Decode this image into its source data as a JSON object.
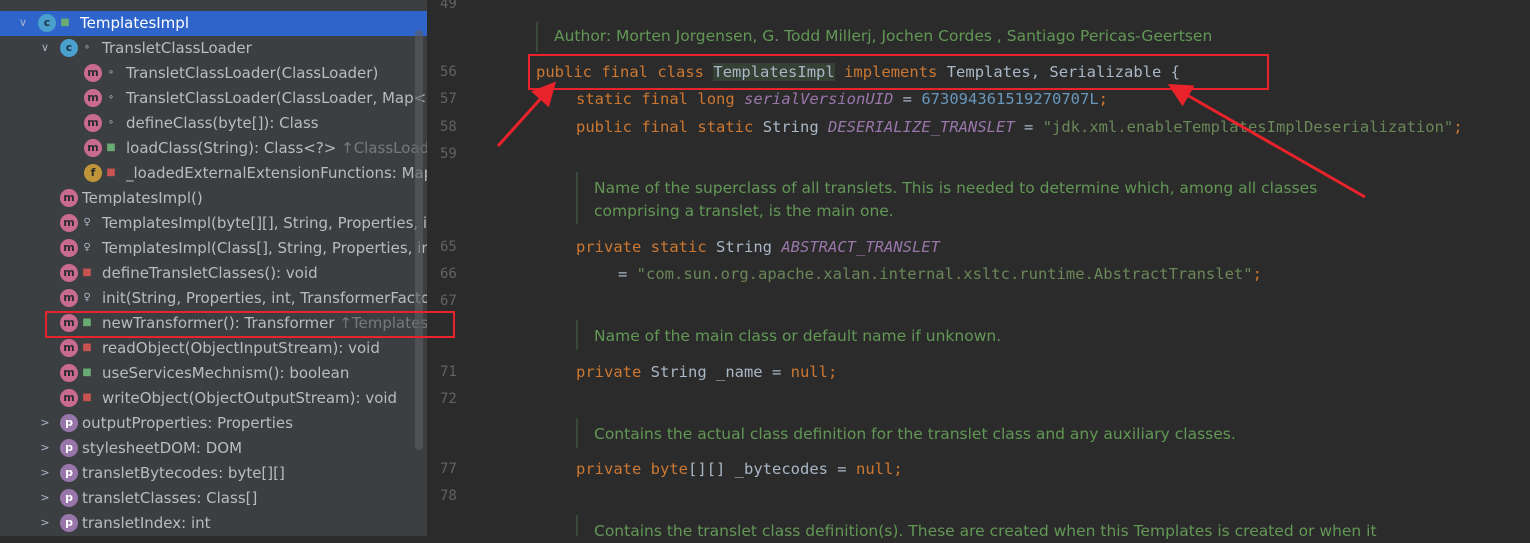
{
  "structure": {
    "rows": [
      {
        "arrow": "down",
        "icon": "c",
        "icon_name": "class-icon",
        "vis": "pub",
        "label": "TemplatesImpl",
        "hint": "",
        "selected": true
      },
      {
        "arrow": "down",
        "icon": "c",
        "icon_name": "inner-class-icon",
        "vis": "dot",
        "label": "TransletClassLoader",
        "hint": ""
      },
      {
        "icon": "m",
        "icon_name": "method-icon",
        "vis": "dot",
        "label": "TransletClassLoader(ClassLoader)",
        "hint": ""
      },
      {
        "icon": "m",
        "icon_name": "method-icon",
        "vis": "dot",
        "label": "TransletClassLoader(ClassLoader, Map<St",
        "hint": ""
      },
      {
        "icon": "m",
        "icon_name": "method-icon",
        "vis": "dot",
        "label": "defineClass(byte[]): Class",
        "hint": ""
      },
      {
        "icon": "m",
        "icon_name": "method-icon",
        "vis": "pub",
        "label": "loadClass(String): Class<?>",
        "hint": "↑ClassLoader"
      },
      {
        "icon": "f",
        "icon_name": "field-icon",
        "vis": "priv",
        "label": "_loadedExternalExtensionFunctions: Map<",
        "hint": ""
      },
      {
        "icon": "m",
        "icon_name": "method-icon",
        "vis": "none",
        "label": "TemplatesImpl()",
        "hint": ""
      },
      {
        "icon": "m",
        "icon_name": "method-icon",
        "vis": "pkg",
        "label": "TemplatesImpl(byte[][], String, Properties, in",
        "hint": ""
      },
      {
        "icon": "m",
        "icon_name": "method-icon",
        "vis": "pkg",
        "label": "TemplatesImpl(Class[], String, Properties, int",
        "hint": ""
      },
      {
        "icon": "m",
        "icon_name": "method-icon",
        "vis": "priv",
        "label": "defineTransletClasses(): void",
        "hint": ""
      },
      {
        "icon": "m",
        "icon_name": "method-icon",
        "vis": "pkg",
        "label": "init(String, Properties, int, TransformerFactor",
        "hint": ""
      },
      {
        "icon": "m",
        "icon_name": "method-icon",
        "vis": "pub",
        "label": "newTransformer(): Transformer",
        "hint": "↑Templates"
      },
      {
        "icon": "m",
        "icon_name": "method-icon",
        "vis": "priv",
        "label": "readObject(ObjectInputStream): void",
        "hint": ""
      },
      {
        "icon": "m",
        "icon_name": "method-icon",
        "vis": "pub",
        "label": "useServicesMechnism(): boolean",
        "hint": ""
      },
      {
        "icon": "m",
        "icon_name": "method-icon",
        "vis": "priv",
        "label": "writeObject(ObjectOutputStream): void",
        "hint": ""
      },
      {
        "arrow": "right",
        "icon": "p",
        "icon_name": "property-icon",
        "vis": "none",
        "label": "outputProperties: Properties",
        "hint": ""
      },
      {
        "arrow": "right",
        "icon": "p",
        "icon_name": "property-icon",
        "vis": "none",
        "label": "stylesheetDOM: DOM",
        "hint": ""
      },
      {
        "arrow": "right",
        "icon": "p",
        "icon_name": "property-icon",
        "vis": "none",
        "label": "transletBytecodes: byte[][]",
        "hint": ""
      },
      {
        "arrow": "right",
        "icon": "p",
        "icon_name": "property-icon",
        "vis": "none",
        "label": "transletClasses: Class[]",
        "hint": ""
      },
      {
        "arrow": "right",
        "icon": "p",
        "icon_name": "property-icon",
        "vis": "none",
        "label": "transletIndex: int",
        "hint": ""
      }
    ]
  },
  "editor": {
    "line_numbers": [
      "49",
      "56",
      "57",
      "58",
      "59",
      "65",
      "66",
      "67",
      "71",
      "72",
      "77",
      "78"
    ],
    "author_doc": "Author: Morten Jorgensen, G. Todd Millerj, Jochen Cordes , Santiago Pericas-Geertsen",
    "doc1_line1": "Name of the superclass of all translets. This is needed to determine which, among all classes",
    "doc1_line2": "comprising a translet, is the main one.",
    "doc2": "Name of the main class or default name if unknown.",
    "doc3": "Contains the actual class definition for the translet class and any auxiliary classes.",
    "doc4": "Contains the translet class definition(s). These are created when this Templates is created or when it",
    "code": {
      "l56": [
        "public",
        " ",
        "final",
        " ",
        "class",
        " ",
        "TemplatesImpl",
        " ",
        "implements",
        " Templates, Serializable {"
      ],
      "l57": [
        "static",
        " ",
        "final",
        " ",
        "long",
        " ",
        "serialVersionUID",
        " = ",
        "673094361519270707L",
        ";"
      ],
      "l58": [
        "public",
        " ",
        "final",
        " ",
        "static",
        " String ",
        "DESERIALIZE_TRANSLET",
        " = ",
        "\"jdk.xml.enableTemplatesImplDeserialization\"",
        ";"
      ],
      "l65": [
        "private",
        " ",
        "static",
        " String ",
        "ABSTRACT_TRANSLET"
      ],
      "l66": [
        "= ",
        "\"com.sun.org.apache.xalan.internal.xsltc.runtime.AbstractTranslet\"",
        ";"
      ],
      "l71": [
        "private",
        " String _name = ",
        "null",
        ";"
      ],
      "l77": [
        "private",
        " ",
        "byte",
        "[][] _bytecodes = ",
        "null",
        ";"
      ]
    }
  },
  "colors": {
    "keyword": "#cc7832",
    "string": "#6a8759",
    "number": "#6897bb",
    "field": "#9876aa",
    "doc": "#629755",
    "highlight": "#e8232b",
    "selection": "#2f65ca"
  }
}
